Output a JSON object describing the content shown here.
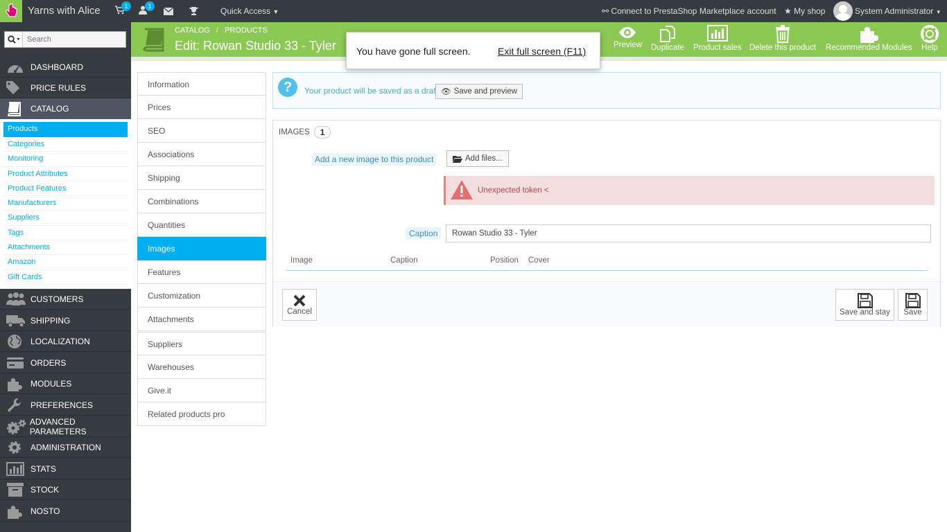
{
  "topbar": {
    "shop_name": "Yarns with Alice",
    "cart_badge": "1",
    "customers_badge": "1",
    "quick_access": "Quick Access",
    "connect": "Connect to PrestaShop Marketplace account",
    "my_shop": "My shop",
    "admin": "System Administrator"
  },
  "search": {
    "placeholder": "Search"
  },
  "sidebar": {
    "items": [
      {
        "label": "DASHBOARD",
        "icon": "dashboard-icon"
      },
      {
        "label": "PRICE RULES",
        "icon": "tags-icon"
      },
      {
        "label": "CATALOG",
        "icon": "book-icon"
      },
      {
        "label": "CUSTOMERS",
        "icon": "users-icon"
      },
      {
        "label": "SHIPPING",
        "icon": "truck-icon"
      },
      {
        "label": "LOCALIZATION",
        "icon": "globe-icon"
      },
      {
        "label": "ORDERS",
        "icon": "credit-card-icon"
      },
      {
        "label": "MODULES",
        "icon": "puzzle-icon"
      },
      {
        "label": "PREFERENCES",
        "icon": "wrench-icon"
      },
      {
        "label": "ADVANCED PARAMETERS",
        "icon": "cogs-icon"
      },
      {
        "label": "ADMINISTRATION",
        "icon": "cog-icon"
      },
      {
        "label": "STATS",
        "icon": "bar-chart-icon"
      },
      {
        "label": "STOCK",
        "icon": "archive-icon"
      },
      {
        "label": "NOSTO",
        "icon": "puzzle-icon"
      }
    ],
    "catalog_sub": [
      "Products",
      "Categories",
      "Monitoring",
      "Product Attributes",
      "Product Features",
      "Manufacturers",
      "Suppliers",
      "Tags",
      "Attachments",
      "Amazon",
      "Gift Cards"
    ]
  },
  "header": {
    "breadcrumb_1": "CATALOG",
    "breadcrumb_sep": "/",
    "breadcrumb_2": "PRODUCTS",
    "title": "Edit: Rowan Studio 33 - Tyler",
    "actions": [
      "Preview",
      "Duplicate",
      "Product sales",
      "Delete this product",
      "Recommended Modules",
      "Help"
    ]
  },
  "fullscreen": {
    "message": "You have gone full screen.",
    "exit": "Exit full screen (F11)"
  },
  "tabs": [
    "Information",
    "Prices",
    "SEO",
    "Associations",
    "Shipping",
    "Combinations",
    "Quantities",
    "Images",
    "Features",
    "Customization",
    "Attachments",
    "Suppliers",
    "Warehouses",
    "Give.it",
    "Related products pro"
  ],
  "draft": {
    "text": "Your product will be saved as a draft.",
    "button": "Save and preview"
  },
  "images": {
    "heading": "IMAGES",
    "count": "1",
    "add_label": "Add a new image to this product",
    "add_button": "Add files...",
    "error": "Unexpected token <",
    "caption_label": "Caption",
    "caption_value": "Rowan Studio 33 - Tyler",
    "columns": [
      "Image",
      "Caption",
      "Position",
      "Cover"
    ]
  },
  "footer": {
    "cancel": "Cancel",
    "save_stay": "Save and stay",
    "save": "Save"
  },
  "colors": {
    "accent_green": "#8bc954",
    "accent_blue": "#00aff0",
    "sidebar_bg": "#363a41",
    "error_bg": "#f2dede"
  }
}
